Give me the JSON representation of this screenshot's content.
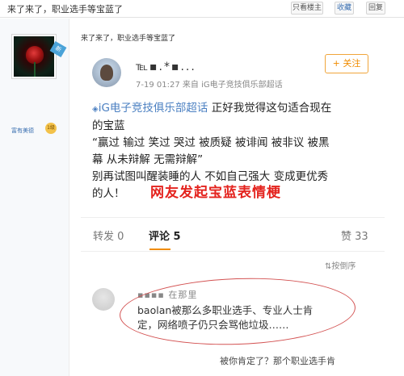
{
  "topbar": {
    "title": "来了来了，职业选手等宝蓝了",
    "only_op": "只看楼主",
    "mid_btn": "收藏",
    "last_btn": "回复"
  },
  "user": {
    "new_badge": "新",
    "rank_label": "富有美德",
    "rank_badge": "1级"
  },
  "reply": {
    "heading": "来了来了，职业选手等宝蓝了"
  },
  "weibo": {
    "username": "℡▪.*▪...",
    "meta_time": "7-19 01:27",
    "meta_source": "来自 iG电子竞技俱乐部超话",
    "follow": "+ 关注",
    "body": {
      "line1_topic": "iG电子竞技俱乐部超话",
      "line1_rest": " 正好我觉得这句适合现在",
      "line2": "的宝蓝",
      "line3": "“赢过 输过 笑过 哭过 被质疑 被诽闻 被非议 被黑",
      "line4": "幕 从未辩解 无需辩解”",
      "line5": "别再试图叫醒装睡的人 不如自己强大 变成更优秀",
      "line6": "的人！"
    },
    "caption": "网友发起宝蓝表情梗",
    "stats": {
      "repost": "转发 0",
      "comment": "评论 5",
      "like": "赞 33"
    },
    "sort": "⇅按倒序",
    "comment": {
      "name": "▪▪▪▪ 在那里",
      "text_line1": "baolan被那么多职业选手、专业人士肯",
      "text_line2": "定，网络喷子仍只会骂他垃圾……",
      "reply_preview": "被你肯定了？那个职业选手肯"
    }
  }
}
